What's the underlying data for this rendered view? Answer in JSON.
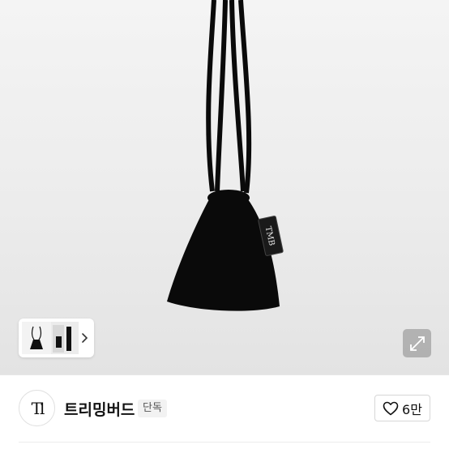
{
  "hero": {
    "product_tag_text": "TMB"
  },
  "thumbnails": {
    "next_icon": "chevron-right-icon"
  },
  "expand": {
    "icon": "expand-arrows-icon"
  },
  "brand": {
    "logo_text": "Tl",
    "name": "트리밍버드",
    "badge": "단독",
    "like_icon": "heart-outline-icon",
    "like_count": "6만"
  }
}
